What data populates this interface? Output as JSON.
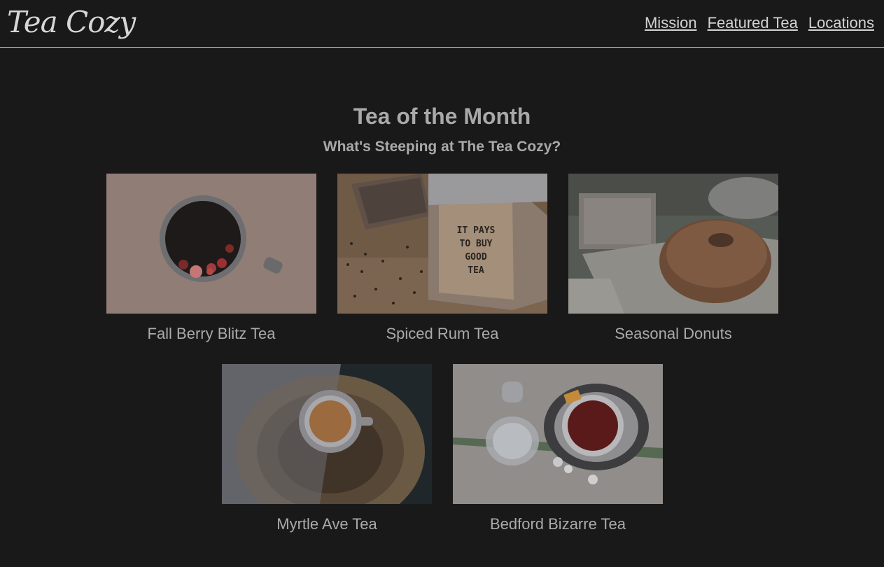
{
  "header": {
    "logo": "Tea Cozy",
    "nav": [
      {
        "label": "Mission"
      },
      {
        "label": "Featured Tea"
      },
      {
        "label": "Locations"
      }
    ]
  },
  "main": {
    "title": "Tea of the Month",
    "subtitle": "What's Steeping at The Tea Cozy?",
    "items": [
      {
        "caption": "Fall Berry Blitz Tea"
      },
      {
        "caption": "Spiced Rum Tea"
      },
      {
        "caption": "Seasonal Donuts"
      },
      {
        "caption": "Myrtle Ave Tea"
      },
      {
        "caption": "Bedford Bizarre Tea"
      }
    ],
    "box_text": [
      "IT PAYS",
      "TO BUY",
      "GOOD",
      "TEA"
    ]
  }
}
